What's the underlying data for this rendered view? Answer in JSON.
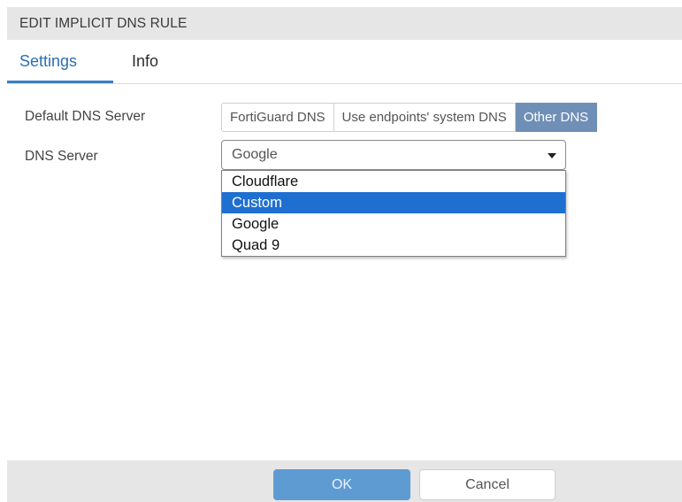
{
  "dialog": {
    "title": "EDIT IMPLICIT DNS RULE"
  },
  "tabs": [
    {
      "label": "Settings",
      "active": true
    },
    {
      "label": "Info",
      "active": false
    }
  ],
  "form": {
    "default_dns_label": "Default DNS Server",
    "default_dns_options": [
      {
        "label": "FortiGuard DNS",
        "selected": false
      },
      {
        "label": "Use endpoints' system DNS",
        "selected": false
      },
      {
        "label": "Other DNS",
        "selected": true
      }
    ],
    "dns_server_label": "DNS Server",
    "dns_server_value": "Google",
    "dns_server_options": [
      {
        "label": "Cloudflare",
        "highlighted": false
      },
      {
        "label": "Custom",
        "highlighted": true
      },
      {
        "label": "Google",
        "highlighted": false
      },
      {
        "label": "Quad 9",
        "highlighted": false
      }
    ]
  },
  "footer": {
    "ok_label": "OK",
    "cancel_label": "Cancel"
  },
  "colors": {
    "accent": "#3a7ec4",
    "selected_segment": "#6f8fb6",
    "highlight": "#1f6fd0",
    "ok_button": "#5f9bd3",
    "header_bg": "#e6e6e6"
  },
  "icons": {
    "dropdown_caret": "caret-down-icon"
  }
}
